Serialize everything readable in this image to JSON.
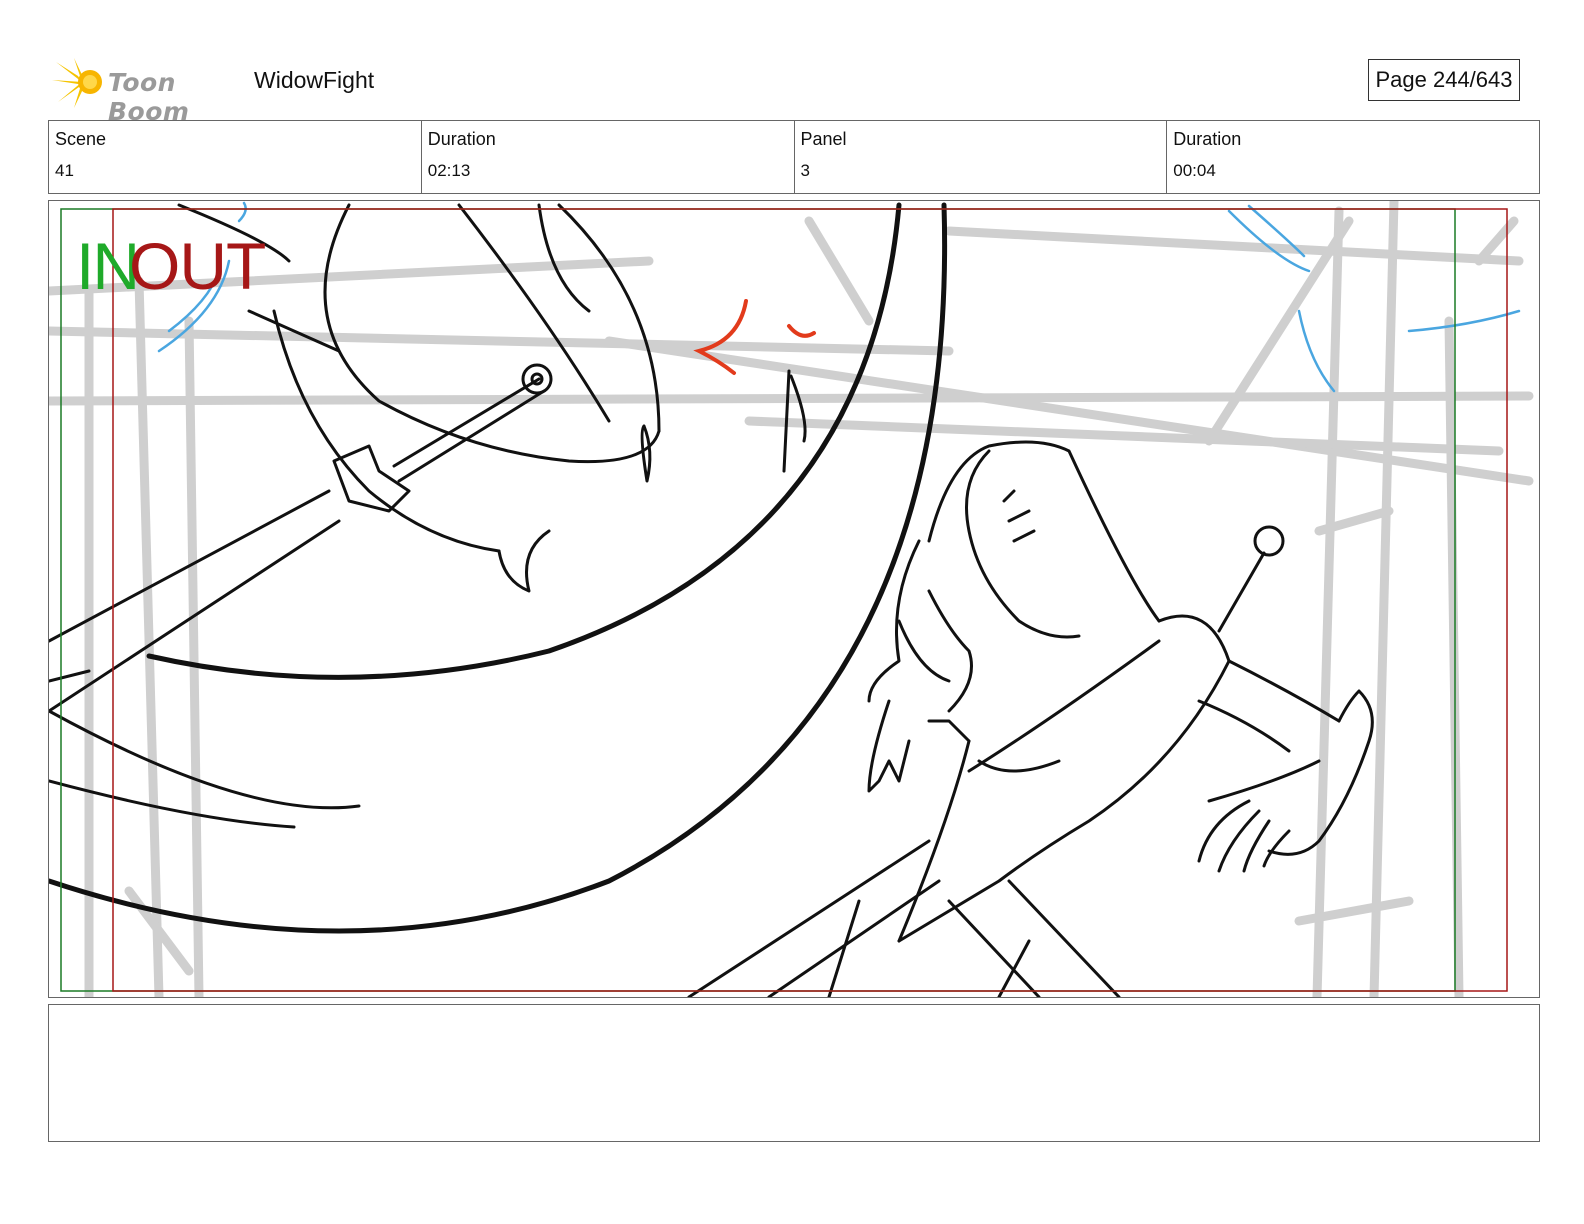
{
  "header": {
    "brand": "Toon Boom",
    "project_title": "WidowFight",
    "page_label": "Page 244/643"
  },
  "info": {
    "scene_label": "Scene",
    "scene_value": "41",
    "scene_duration_label": "Duration",
    "scene_duration_value": "02:13",
    "panel_label": "Panel",
    "panel_value": "3",
    "panel_duration_label": "Duration",
    "panel_duration_value": "00:04"
  },
  "panel": {
    "in_marker": "IN",
    "out_marker": "OUT",
    "in_color": "#1faa2a",
    "out_color": "#a61717"
  },
  "notes": {
    "dialogue": ""
  }
}
